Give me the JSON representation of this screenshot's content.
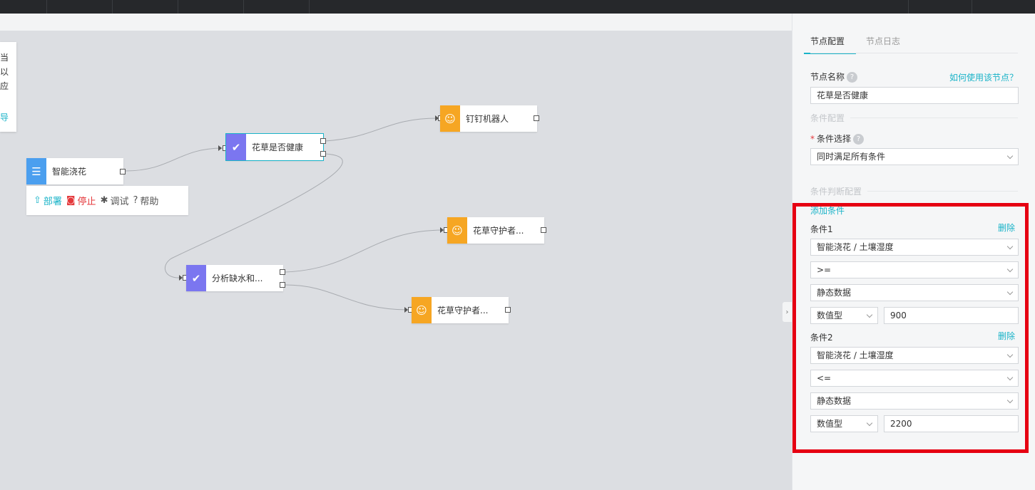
{
  "tip_card": {
    "lines": [
      "当",
      "以",
      "应",
      "导"
    ]
  },
  "nodes": {
    "smart_watering": {
      "label": "智能浇花",
      "icon": "list-icon",
      "color": "#4b9fef"
    },
    "flower_health": {
      "label": "花草是否健康",
      "icon": "check-icon",
      "color": "#7b76f0"
    },
    "dingtalk_bot": {
      "label": "钉钉机器人",
      "icon": "robot-icon",
      "color": "#f6a623"
    },
    "guardian_1": {
      "label": "花草守护者...",
      "icon": "robot-icon",
      "color": "#f6a623"
    },
    "analyze": {
      "label": "分析缺水和...",
      "icon": "check-icon",
      "color": "#7b76f0"
    },
    "guardian_2": {
      "label": "花草守护者...",
      "icon": "robot-icon",
      "color": "#f6a623"
    }
  },
  "toolbar": {
    "deploy": "部署",
    "stop": "停止",
    "debug": "调试",
    "help": "帮助"
  },
  "panel": {
    "tabs": [
      "节点配置",
      "节点日志"
    ],
    "node_name_label": "节点名称",
    "how_to_use": "如何使用该节点？",
    "node_name_value": "花草是否健康",
    "condition_config": "条件配置",
    "condition_select_label": "条件选择",
    "condition_select_value": "同时满足所有条件",
    "condition_judge_config": "条件判断配置",
    "add_condition": "添加条件",
    "delete": "删除",
    "conditions": [
      {
        "title": "条件1",
        "source": "智能浇花 / 土壤湿度",
        "operator": ">=",
        "data_kind": "静态数据",
        "value_type": "数值型",
        "value": "900"
      },
      {
        "title": "条件2",
        "source": "智能浇花 / 土壤湿度",
        "operator": "<=",
        "data_kind": "静态数据",
        "value_type": "数值型",
        "value": "2200"
      }
    ]
  }
}
